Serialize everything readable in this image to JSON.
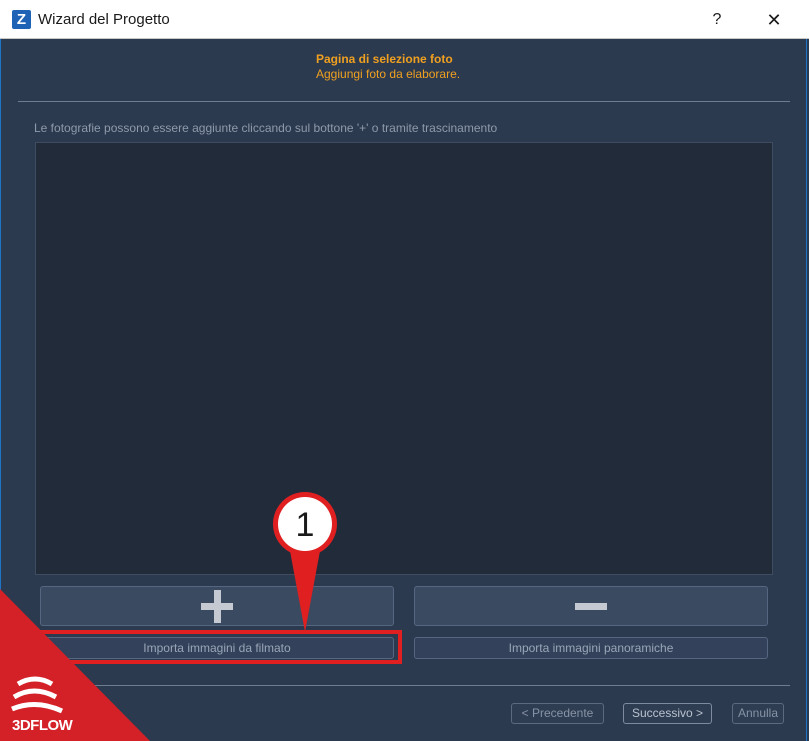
{
  "window": {
    "title": "Wizard del Progetto",
    "logo_letter": "Z",
    "help_label": "?",
    "close_label": "✕"
  },
  "header": {
    "title": "Pagina di selezione foto",
    "subtitle": "Aggiungi foto da elaborare."
  },
  "main": {
    "instructions": "Le fotografie possono essere aggiunte cliccando sul bottone '+' o tramite trascinamento",
    "import_video_label": "Importa immagini da filmato",
    "import_panoramic_label": "Importa immagini panoramiche"
  },
  "footer": {
    "prev_label": "< Precedente",
    "next_label": "Successivo >",
    "cancel_label": "Annulla"
  },
  "annotation": {
    "marker_number": "1"
  },
  "brand": {
    "text": "3DFLOW"
  },
  "colors": {
    "accent_orange": "#f0a020",
    "highlight_red": "#e02020",
    "background": "#2c3a4f",
    "drop_area": "#212b3a"
  }
}
